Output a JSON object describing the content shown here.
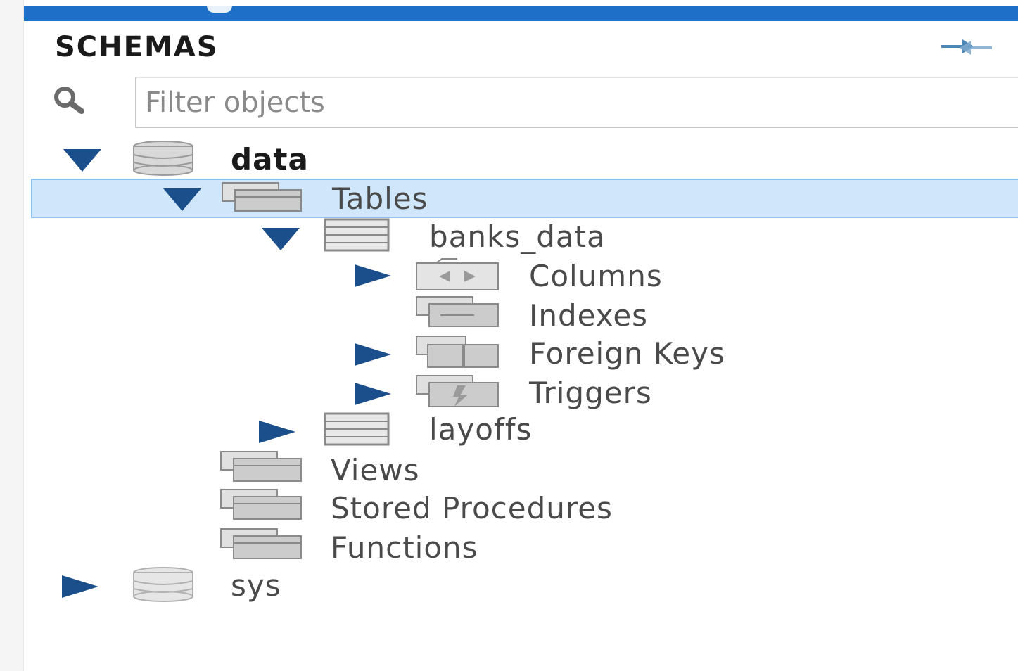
{
  "panel": {
    "title": "SCHEMAS",
    "refresh_icon": "refresh-icon",
    "search_icon": "search-icon",
    "filter_placeholder": "Filter objects"
  },
  "tree": {
    "schema_data": {
      "label": "data",
      "icon": "database-icon",
      "expanded": true
    },
    "tables": {
      "label": "Tables",
      "icon": "folder-icon",
      "expanded": true,
      "selected": true
    },
    "banks_data": {
      "label": "banks_data",
      "icon": "table-icon",
      "expanded": true
    },
    "columns": {
      "label": "Columns",
      "icon": "columns-folder-icon",
      "expanded": false
    },
    "indexes": {
      "label": "Indexes",
      "icon": "indexes-folder-icon"
    },
    "foreign_keys": {
      "label": "Foreign Keys",
      "icon": "foreign-keys-folder-icon",
      "expanded": false
    },
    "triggers": {
      "label": "Triggers",
      "icon": "triggers-folder-icon",
      "expanded": false
    },
    "layoffs": {
      "label": "layoffs",
      "icon": "table-icon",
      "expanded": false
    },
    "views": {
      "label": "Views",
      "icon": "folder-icon"
    },
    "stored_procedures": {
      "label": "Stored Procedures",
      "icon": "folder-icon"
    },
    "functions": {
      "label": "Functions",
      "icon": "folder-icon"
    },
    "schema_sys": {
      "label": "sys",
      "icon": "database-icon",
      "expanded": false
    }
  },
  "colors": {
    "accent": "#1e6fc8",
    "selection": "#cfe6fb",
    "selection_border": "#8fc1ee",
    "caret": "#1b4f8c"
  }
}
